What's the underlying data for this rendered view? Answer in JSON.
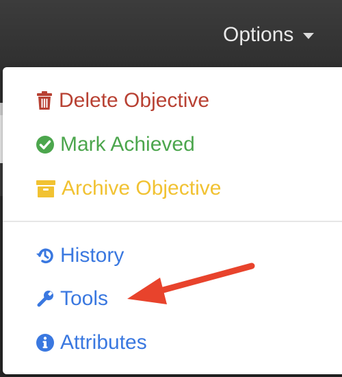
{
  "options_menu": {
    "toggle_label": "Options",
    "colors": {
      "danger": "#b84133",
      "success": "#4ca64d",
      "warning": "#f1c232",
      "link": "#3a78e0"
    },
    "items": [
      {
        "label": "Delete Objective",
        "icon": "trash-icon"
      },
      {
        "label": "Mark Achieved",
        "icon": "check-circle-icon"
      },
      {
        "label": "Archive Objective",
        "icon": "archive-box-icon"
      },
      {
        "label": "History",
        "icon": "history-icon"
      },
      {
        "label": "Tools",
        "icon": "wrench-icon"
      },
      {
        "label": "Attributes",
        "icon": "info-circle-icon"
      }
    ]
  },
  "annotation": {
    "arrow_color": "#e8432c",
    "icon": "red-arrow-pointing-to-tools"
  }
}
